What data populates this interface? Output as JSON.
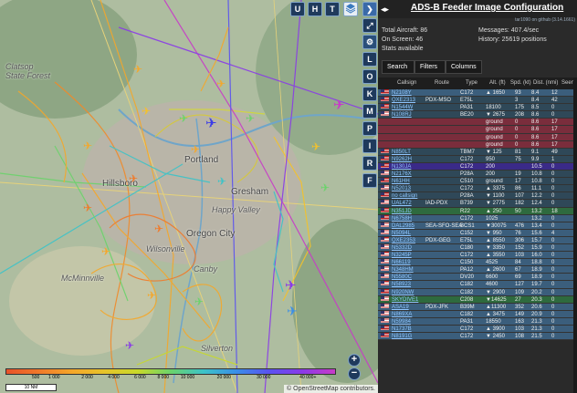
{
  "map": {
    "labels": [
      {
        "text": "Clatsop\nState Forest",
        "cls": ""
      },
      {
        "text": "Portland",
        "cls": "city"
      },
      {
        "text": "Hillsboro",
        "cls": "city"
      },
      {
        "text": "Gresham",
        "cls": "city"
      },
      {
        "text": "Oregon City",
        "cls": "city"
      },
      {
        "text": "Wilsonville",
        "cls": ""
      },
      {
        "text": "Canby",
        "cls": ""
      },
      {
        "text": "Silverton",
        "cls": ""
      },
      {
        "text": "McMinnville",
        "cls": ""
      },
      {
        "text": "Happy Valley",
        "cls": ""
      }
    ],
    "top_buttons": [
      "U",
      "H",
      "T"
    ],
    "side_buttons": [
      "L",
      "O",
      "K",
      "M",
      "P",
      "I",
      "R",
      "F"
    ],
    "legend_ticks": [
      "500",
      "1 000",
      "2 000",
      "4 000",
      "6 000",
      "8 000",
      "10 000",
      "20 000",
      "30 000",
      "40 000+"
    ],
    "scale": "10 NM",
    "attribution": "© OpenStreetMap contributors.",
    "zoom_in": "+",
    "zoom_out": "−"
  },
  "panel": {
    "title": "ADS-B Feeder Image Configuration",
    "version": "tar1090 on github (3.14.1661)",
    "stats": {
      "total_aircraft": "Total Aircraft: 86",
      "on_screen": "On Screen: 46",
      "stats_available": "Stats available",
      "messages": "Messages: 407.4/sec",
      "history": "History: 25619 positions"
    },
    "tabs": [
      "Search",
      "Filters",
      "Columns"
    ],
    "columns": [
      "Callsign",
      "Route",
      "Type",
      "Alt. (ft)",
      "Spd. (kt)",
      "Dist. (nmi)",
      "Seen"
    ],
    "rows": [
      {
        "callsign": "N2108Y",
        "route": "",
        "type": "C172",
        "alt": "▲ 1650",
        "spd": "93",
        "dist": "8.4",
        "seen": "12",
        "style": "r-blue",
        "flag": true
      },
      {
        "callsign": "QXE2313",
        "route": "PDX-MSO",
        "type": "E75L",
        "alt": "",
        "spd": "3",
        "dist": "8.4",
        "seen": "42",
        "style": "r-dark",
        "flag": true
      },
      {
        "callsign": "N1544W",
        "route": "",
        "type": "PA31",
        "alt": "18100",
        "spd": "175",
        "dist": "8.5",
        "seen": "0",
        "style": "r-dark",
        "flag": true
      },
      {
        "callsign": "N108RJ",
        "route": "",
        "type": "BE20",
        "alt": "▼ 2675",
        "spd": "208",
        "dist": "8.6",
        "seen": "0",
        "style": "r-dark",
        "flag": true
      },
      {
        "callsign": "",
        "route": "",
        "type": "",
        "alt": "ground",
        "spd": "0",
        "dist": "8.6",
        "seen": "17",
        "style": "r-red",
        "flag": false
      },
      {
        "callsign": "",
        "route": "",
        "type": "",
        "alt": "ground",
        "spd": "0",
        "dist": "8.6",
        "seen": "17",
        "style": "r-red",
        "flag": false
      },
      {
        "callsign": "",
        "route": "",
        "type": "",
        "alt": "ground",
        "spd": "0",
        "dist": "8.6",
        "seen": "17",
        "style": "r-red",
        "flag": false
      },
      {
        "callsign": "",
        "route": "",
        "type": "",
        "alt": "ground",
        "spd": "0",
        "dist": "8.6",
        "seen": "17",
        "style": "r-red",
        "flag": false
      },
      {
        "callsign": "N850LT",
        "route": "",
        "type": "TBM7",
        "alt": "▼ 125",
        "spd": "81",
        "dist": "9.1",
        "seen": "49",
        "style": "r-dark",
        "flag": true
      },
      {
        "callsign": "N9262H",
        "route": "",
        "type": "C172",
        "alt": "950",
        "spd": "75",
        "dist": "9.9",
        "seen": "1",
        "style": "r-dark",
        "flag": true
      },
      {
        "callsign": "N130JA",
        "route": "",
        "type": "C172",
        "alt": "200",
        "spd": "",
        "dist": "10.5",
        "seen": "0",
        "style": "r-sel",
        "flag": true
      },
      {
        "callsign": "N2176X",
        "route": "",
        "type": "P28A",
        "alt": "200",
        "spd": "19",
        "dist": "10.8",
        "seen": "0",
        "style": "r-dark",
        "flag": true
      },
      {
        "callsign": "N61HH",
        "route": "",
        "type": "C510",
        "alt": "ground",
        "spd": "17",
        "dist": "10.8",
        "seen": "0",
        "style": "r-dark",
        "flag": true
      },
      {
        "callsign": "N52013",
        "route": "",
        "type": "C172",
        "alt": "▲ 3375",
        "spd": "86",
        "dist": "11.1",
        "seen": "0",
        "style": "r-dark",
        "flag": true
      },
      {
        "callsign": "no callsign",
        "route": "",
        "type": "P28A",
        "alt": "▼ 1100",
        "spd": "107",
        "dist": "12.2",
        "seen": "0",
        "style": "r-dark",
        "flag": true
      },
      {
        "callsign": "UAL472",
        "route": "IAD-PDX",
        "type": "B739",
        "alt": "▼ 2775",
        "spd": "182",
        "dist": "12.4",
        "seen": "0",
        "style": "r-dark",
        "flag": true
      },
      {
        "callsign": "N351JD",
        "route": "",
        "type": "R22",
        "alt": "▲ 250",
        "spd": "50",
        "dist": "13.2",
        "seen": "18",
        "style": "r-green",
        "flag": true
      },
      {
        "callsign": "N6758H",
        "route": "",
        "type": "C172",
        "alt": "1025",
        "spd": "",
        "dist": "13.2",
        "seen": "0",
        "style": "r-blue",
        "flag": true
      },
      {
        "callsign": "DAL2985",
        "route": "SEA-SFO-SEA",
        "type": "BCS1",
        "alt": "▼30075",
        "spd": "476",
        "dist": "13.4",
        "seen": "0",
        "style": "r-blue",
        "flag": true
      },
      {
        "callsign": "N5094L",
        "route": "",
        "type": "C152",
        "alt": "▼ 950",
        "spd": "76",
        "dist": "15.6",
        "seen": "4",
        "style": "r-blue",
        "flag": true
      },
      {
        "callsign": "QXE2353",
        "route": "PDX-GEG",
        "type": "E75L",
        "alt": "▲ 8550",
        "spd": "306",
        "dist": "15.7",
        "seen": "0",
        "style": "r-blue",
        "flag": true
      },
      {
        "callsign": "N5332D",
        "route": "",
        "type": "C180",
        "alt": "▼ 3350",
        "spd": "152",
        "dist": "15.9",
        "seen": "0",
        "style": "r-blue",
        "flag": true
      },
      {
        "callsign": "N3245P",
        "route": "",
        "type": "C172",
        "alt": "▲ 3550",
        "spd": "103",
        "dist": "16.0",
        "seen": "0",
        "style": "r-blue",
        "flag": true
      },
      {
        "callsign": "N66119",
        "route": "",
        "type": "C150",
        "alt": "4525",
        "spd": "84",
        "dist": "18.8",
        "seen": "0",
        "style": "r-blue",
        "flag": true
      },
      {
        "callsign": "N348HM",
        "route": "",
        "type": "PA12",
        "alt": "▲ 2600",
        "spd": "67",
        "dist": "18.9",
        "seen": "0",
        "style": "r-blue",
        "flag": true
      },
      {
        "callsign": "N5580C",
        "route": "",
        "type": "DV20",
        "alt": "6600",
        "spd": "69",
        "dist": "18.9",
        "seen": "0",
        "style": "r-blue",
        "flag": true
      },
      {
        "callsign": "N58923",
        "route": "",
        "type": "C182",
        "alt": "4600",
        "spd": "127",
        "dist": "19.7",
        "seen": "0",
        "style": "r-blue",
        "flag": true
      },
      {
        "callsign": "N920NW",
        "route": "",
        "type": "C182",
        "alt": "▼ 2900",
        "spd": "109",
        "dist": "20.2",
        "seen": "0",
        "style": "r-blue",
        "flag": true
      },
      {
        "callsign": "SKYDIVE1",
        "route": "",
        "type": "C208",
        "alt": "▼14625",
        "spd": "27",
        "dist": "20.3",
        "seen": "0",
        "style": "r-green",
        "flag": true
      },
      {
        "callsign": "ASA19",
        "route": "PDX-JFK",
        "type": "B39M",
        "alt": "▲11300",
        "spd": "352",
        "dist": "20.6",
        "seen": "0",
        "style": "r-blue",
        "flag": true
      },
      {
        "callsign": "N869XA",
        "route": "",
        "type": "C182",
        "alt": "▲ 3475",
        "spd": "149",
        "dist": "20.9",
        "seen": "0",
        "style": "r-blue",
        "flag": true
      },
      {
        "callsign": "N59984",
        "route": "",
        "type": "PA31",
        "alt": "18550",
        "spd": "163",
        "dist": "21.3",
        "seen": "0",
        "style": "r-blue",
        "flag": true
      },
      {
        "callsign": "N1737B",
        "route": "",
        "type": "C172",
        "alt": "▲ 3900",
        "spd": "103",
        "dist": "21.3",
        "seen": "0",
        "style": "r-blue",
        "flag": true
      },
      {
        "callsign": "N8191G",
        "route": "",
        "type": "C172",
        "alt": "▼ 2450",
        "spd": "108",
        "dist": "21.5",
        "seen": "0",
        "style": "r-blue",
        "flag": true
      }
    ]
  }
}
